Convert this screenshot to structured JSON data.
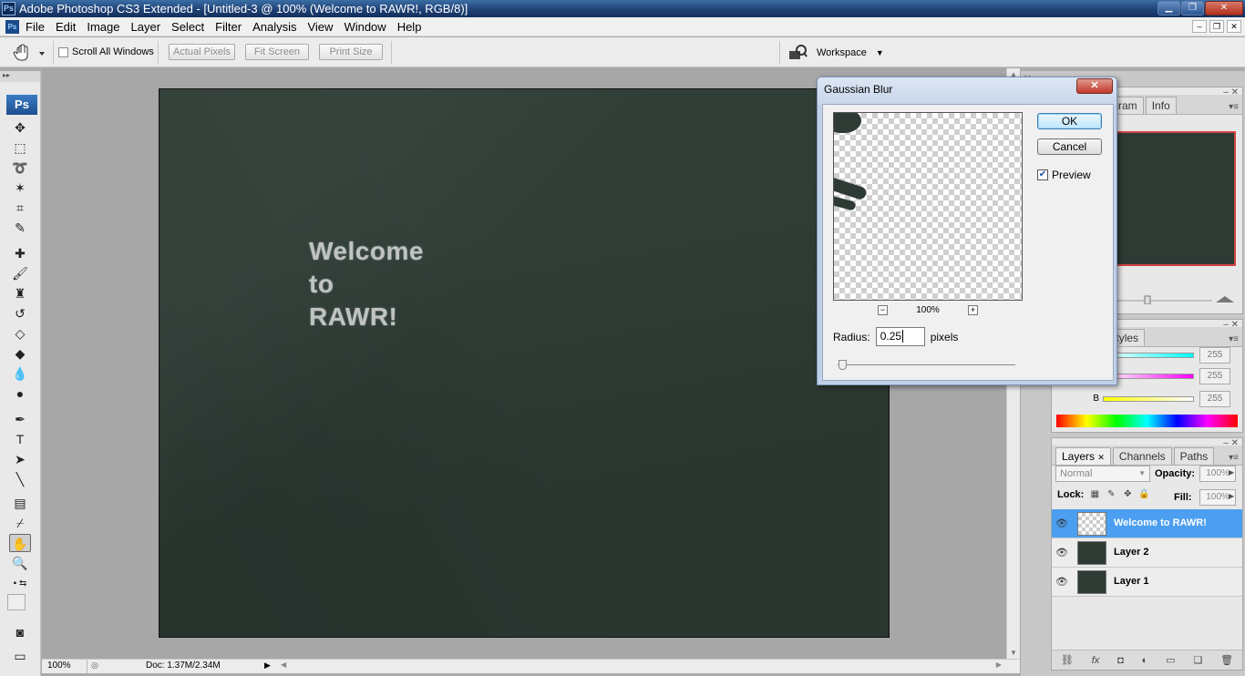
{
  "window": {
    "title": "Adobe Photoshop CS3 Extended - [Untitled-3 @ 100% (Welcome  to RAWR!, RGB/8)]",
    "app_icon_text": "Ps"
  },
  "menu": [
    "File",
    "Edit",
    "Image",
    "Layer",
    "Select",
    "Filter",
    "Analysis",
    "View",
    "Window",
    "Help"
  ],
  "options_bar": {
    "scroll_all_windows": "Scroll All Windows",
    "actual_pixels": "Actual Pixels",
    "fit_screen": "Fit Screen",
    "print_size": "Print Size",
    "workspace": "Workspace"
  },
  "toolbox": {
    "logo": "Ps"
  },
  "canvas": {
    "text": "Welcome\nto\nRAWR!",
    "background_color": "#2c3a33"
  },
  "status_bar": {
    "zoom": "100%",
    "doc": "Doc: 1.37M/2.34M"
  },
  "navigator_panel": {
    "tabs": [
      "Histogram",
      "Info"
    ]
  },
  "color_panel": {
    "tabs": [
      "Swatches",
      "Styles"
    ],
    "visible_tabs": [
      "atches",
      "Styles"
    ],
    "channel_b_label": "B",
    "values": [
      "255",
      "255",
      "255"
    ]
  },
  "layers_panel": {
    "tabs": [
      "Layers",
      "Channels",
      "Paths"
    ],
    "blend_mode": "Normal",
    "opacity_label": "Opacity:",
    "opacity": "100%",
    "lock_label": "Lock:",
    "fill_label": "Fill:",
    "fill": "100%",
    "layers": [
      {
        "name": "Welcome  to RAWR!",
        "selected": true
      },
      {
        "name": "Layer 2",
        "selected": false
      },
      {
        "name": "Layer 1",
        "selected": false
      }
    ]
  },
  "gaussian_blur": {
    "title": "Gaussian Blur",
    "ok": "OK",
    "cancel": "Cancel",
    "preview_label": "Preview",
    "preview_checked": true,
    "zoom": "100%",
    "radius_label": "Radius:",
    "radius_value": "0.25",
    "radius_unit": "pixels"
  }
}
